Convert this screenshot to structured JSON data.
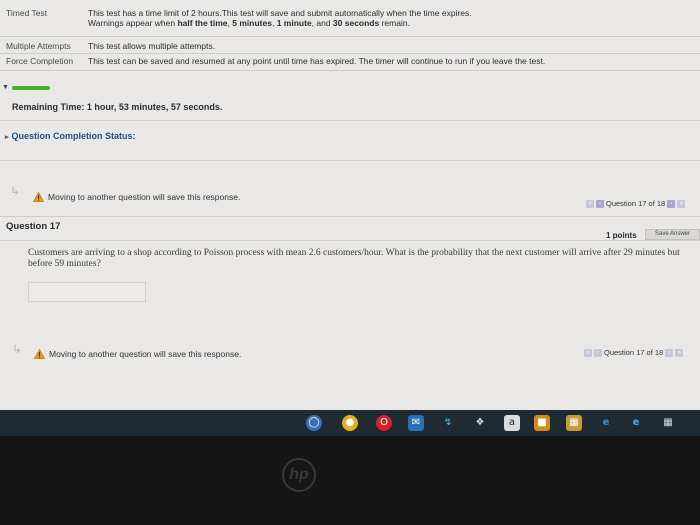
{
  "info": [
    {
      "label": "Timed Test",
      "line1_pre": "This test has a time limit of 2 hours.This test will save and submit automatically when the time expires.",
      "line2_pre": "Warnings appear when ",
      "line2_b1": "half the time",
      "line2_s1": ", ",
      "line2_b2": "5 minutes",
      "line2_s2": ", ",
      "line2_b3": "1 minute",
      "line2_s3": ", and ",
      "line2_b4": "30 seconds",
      "line2_post": " remain."
    },
    {
      "label": "Multiple Attempts",
      "value": "This test allows multiple attempts."
    },
    {
      "label": "Force Completion",
      "value": "This test can be saved and resumed at any point until time has expired. The timer will continue to run if you leave the test."
    }
  ],
  "remaining_time": "Remaining Time: 1 hour, 53 minutes, 57 seconds.",
  "completion_status": "Question Completion Status:",
  "warning_text": "Moving to another question will save this response.",
  "navigation": {
    "label": "Question 17 of 18"
  },
  "question": {
    "title": "Question 17",
    "points": "1 points",
    "save_label": "Save Answer",
    "text": "Customers are arriving to a shop according to Poisson process with mean 2.6 customers/hour. What is the probability that the next customer will arrive after 29 minutes but before 59 minutes?",
    "answer_value": ""
  },
  "taskbar": {
    "icons": [
      "cortana-icon",
      "chrome-icon",
      "opera-icon",
      "mail-icon",
      "stocks-icon",
      "dropbox-icon",
      "amazon-icon",
      "store-icon",
      "files-icon",
      "edge-icon",
      "ie-icon",
      "calculator-icon"
    ]
  },
  "brand": {
    "logo_text": "hp"
  },
  "colors": {
    "progress": "#4caf2e",
    "link": "#1d4f86",
    "warning": "#e8a21a"
  }
}
